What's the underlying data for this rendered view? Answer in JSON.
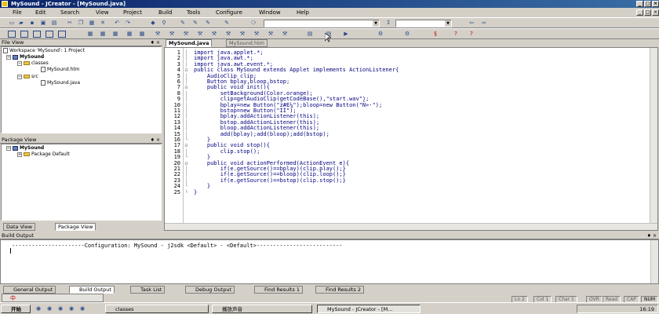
{
  "window": {
    "title": "MySound - JCreator - [MySound.java]"
  },
  "menu": [
    "File",
    "Edit",
    "Search",
    "View",
    "Project",
    "Build",
    "Tools",
    "Configure",
    "Window",
    "Help"
  ],
  "fileview": {
    "title": "File View",
    "workspace": "Workspace 'MySound': 1 Project",
    "project": "MySound",
    "folders": [
      "classes",
      "src"
    ],
    "files": [
      "MySound.htm",
      "MySound.java"
    ],
    "tabs": [
      "Data View",
      "Package View"
    ]
  },
  "packageview": {
    "title": "Package View",
    "project": "MySound",
    "item": "Package Default"
  },
  "editor": {
    "tabs": [
      "MySound.java",
      "MySound.htm"
    ],
    "lines": [
      "import java.applet.*;",
      "import java.awt.*;",
      "import java.awt.event.*;",
      "public class MySound extends Applet implements ActionListener{",
      "    AudioClip clip;",
      "    Button bplay,bloop,bstop;",
      "    public void init(){",
      "        setBackground(Color.orange);",
      "        clip=getAudioClip(getCodeBase(),\"start.wav\");",
      "        bplay=new Button(\"ż#Ε¼\");bloop=new Button(\"Ñ­»·\");",
      "        bstop=new Button(\"ÍÍ\");",
      "        bplay.addActionListener(this);",
      "        bstop.addActionListener(this);",
      "        bloop.addActionListener(this);",
      "        add(bplay);add(bloop);add(bstop);",
      "    }",
      "    public void stop(){",
      "        clip.stop();",
      "    }",
      "    public void actionPerformed(ActionEvent e){",
      "        if(e.getSource()==bplay)(clip.play();}",
      "        if(e.getSource()==bloop)(clip.loop();}",
      "        if(e.getSource()==bstop)(clip.stop();}",
      "    }",
      "}"
    ],
    "line_numbers": [
      "1",
      "2",
      "3",
      "4",
      "5",
      "6",
      "7",
      "8",
      "9",
      "10",
      "11",
      "12",
      "13",
      "14",
      "15",
      "16",
      "17",
      "18",
      "19",
      "20",
      "21",
      "22",
      "23",
      "24",
      "25"
    ]
  },
  "output": {
    "title": "Build Output",
    "line": "----------------------Configuration: MySound - j2sdk <Default> - <Default>--------------------------"
  },
  "bottomtabs": [
    "General Output",
    "Build Output",
    "Task List",
    "Debug Output",
    "Find Results 1",
    "Find Results 2"
  ],
  "status": {
    "ln": "Ln 2",
    "col": "Col 1",
    "char": "Char 1",
    "ovr": "OVR",
    "read": "Read",
    "cap": "CAP",
    "num": "NUM"
  },
  "taskbar": {
    "start": "开始",
    "tasks": [
      "classes",
      "播放声音",
      "MySound - JCreator - [M..."
    ],
    "clock": "16:19"
  },
  "ime": "中"
}
